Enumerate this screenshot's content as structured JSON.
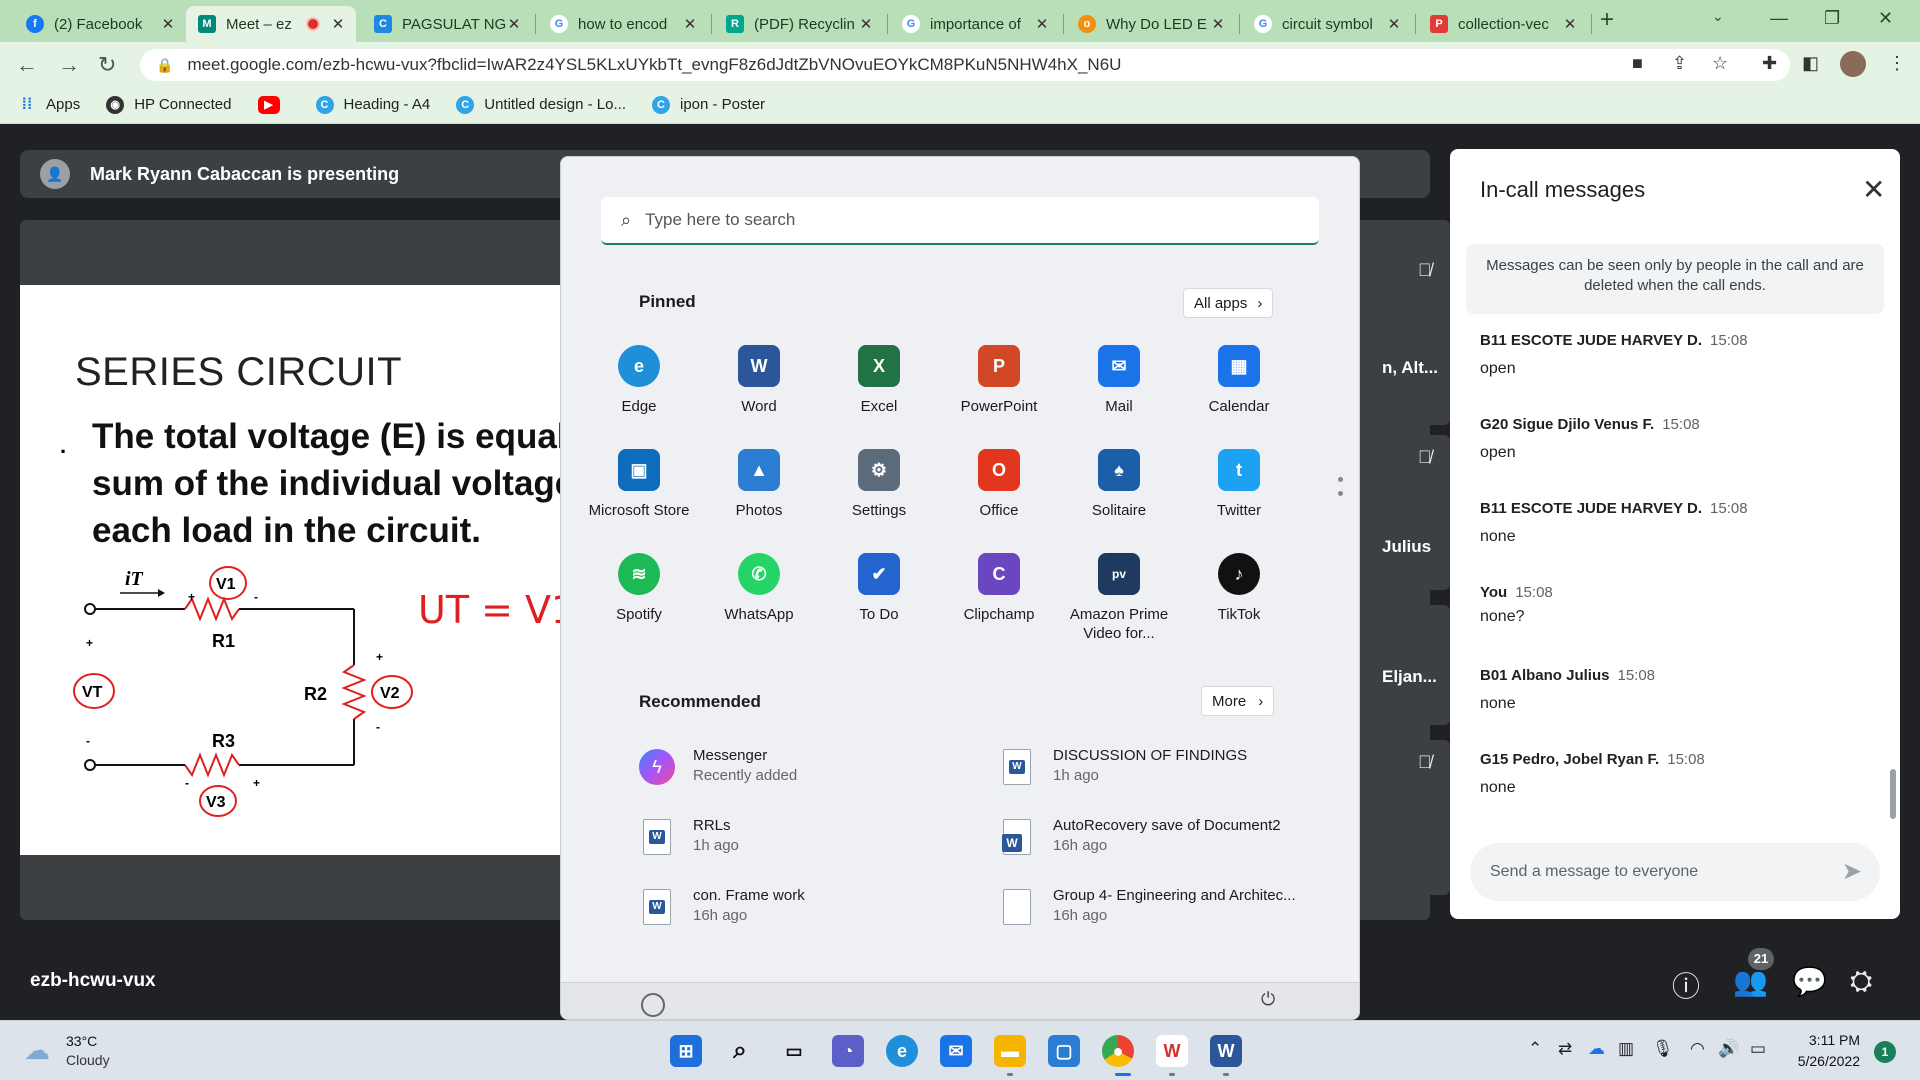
{
  "browser": {
    "tabs": [
      {
        "label": "(2) Facebook",
        "icon": "facebook-icon",
        "color": "#1877f2",
        "glyph": "f"
      },
      {
        "label": "Meet – ez",
        "icon": "google-meet-icon",
        "color": "#00897b",
        "glyph": "M"
      },
      {
        "label": "PAGSULAT NG",
        "icon": "google-classroom-icon",
        "color": "#1e88e5",
        "glyph": "C"
      },
      {
        "label": "how to encod",
        "icon": "google-icon",
        "color": "#4285f4",
        "glyph": "G"
      },
      {
        "label": "(PDF) Recyclin",
        "icon": "researchgate-icon",
        "color": "#00a78e",
        "glyph": "R"
      },
      {
        "label": "importance of",
        "icon": "google-icon",
        "color": "#4285f4",
        "glyph": "G"
      },
      {
        "label": "Why Do LED E",
        "icon": "web-icon",
        "color": "#f29111",
        "glyph": "o"
      },
      {
        "label": "circuit symbol",
        "icon": "google-icon",
        "color": "#4285f4",
        "glyph": "G"
      },
      {
        "label": "collection-vec",
        "icon": "pdf-icon",
        "color": "#e53935",
        "glyph": "P"
      }
    ],
    "new_tab": "+",
    "url": "meet.google.com/ezb-hcwu-vux?fbclid=IwAR2z4YSL5KLxUYkbTt_evngF8z6dJdtZbVNOvuEOYkCM8PKuN5NHW4hX_N6U",
    "bookmarks": [
      {
        "label": "Apps",
        "icon": "apps-grid-icon",
        "color": "#5f6368"
      },
      {
        "label": "HP Connected",
        "icon": "hp-icon",
        "color": "#333333"
      },
      {
        "label": "",
        "icon": "youtube-icon",
        "color": "#ff0000"
      },
      {
        "label": "Heading - A4",
        "icon": "canva-icon",
        "color": "#2fa4e7"
      },
      {
        "label": "Untitled design - Lo...",
        "icon": "canva-icon",
        "color": "#2fa4e7"
      },
      {
        "label": "ipon - Poster",
        "icon": "canva-icon",
        "color": "#2fa4e7"
      }
    ]
  },
  "meet": {
    "presenter_text": "Mark Ryann Cabaccan is presenting",
    "meeting_code": "ezb-hcwu-vux",
    "participant_count": "21",
    "tile_names": [
      "n, Alt...",
      "Julius",
      "Eljan..."
    ]
  },
  "slide": {
    "title": "SERIES CIRCUIT",
    "bullet": ".",
    "body_lines": [
      "The total voltage (E) is equal",
      "sum of the individual voltage",
      "each load in the circuit."
    ],
    "handwritten": "UT = V1 +",
    "labels": {
      "current": "iT",
      "r1": "R1",
      "r2": "R2",
      "r3": "R3",
      "v1": "V1",
      "v2": "V2",
      "v3": "V3",
      "vt": "VT"
    }
  },
  "chat": {
    "title": "In-call messages",
    "notice": "Messages can be seen only by people in the call and are deleted when the call ends.",
    "messages": [
      {
        "sender": "B11 ESCOTE JUDE HARVEY D.",
        "time": "15:08",
        "text": "open"
      },
      {
        "sender": "G20 Sigue Djilo Venus F.",
        "time": "15:08",
        "text": "open"
      },
      {
        "sender": "B11 ESCOTE JUDE HARVEY D.",
        "time": "15:08",
        "text": "none"
      },
      {
        "sender": "You",
        "time": "15:08",
        "text": "none?"
      },
      {
        "sender": "B01 Albano Julius",
        "time": "15:08",
        "text": "none"
      },
      {
        "sender": "G15 Pedro, Jobel Ryan F.",
        "time": "15:08",
        "text": "none"
      }
    ],
    "input_placeholder": "Send a message to everyone"
  },
  "start_menu": {
    "search_placeholder": "Type here to search",
    "pinned_label": "Pinned",
    "all_apps_label": "All apps",
    "pinned": [
      {
        "label": "Edge",
        "icon": "edge-icon",
        "color": "#1e8fd8",
        "glyph": "e"
      },
      {
        "label": "Word",
        "icon": "word-icon",
        "color": "#2b579a",
        "glyph": "W"
      },
      {
        "label": "Excel",
        "icon": "excel-icon",
        "color": "#217346",
        "glyph": "X"
      },
      {
        "label": "PowerPoint",
        "icon": "powerpoint-icon",
        "color": "#d24726",
        "glyph": "P"
      },
      {
        "label": "Mail",
        "icon": "mail-icon",
        "color": "#1a73e8",
        "glyph": "✉"
      },
      {
        "label": "Calendar",
        "icon": "calendar-icon",
        "color": "#1a73e8",
        "glyph": "▦"
      },
      {
        "label": "Microsoft Store",
        "icon": "store-icon",
        "color": "#0f6cbd",
        "glyph": "▣"
      },
      {
        "label": "Photos",
        "icon": "photos-icon",
        "color": "#2b7cd3",
        "glyph": "▲"
      },
      {
        "label": "Settings",
        "icon": "settings-icon",
        "color": "#5b6b7c",
        "glyph": "⚙"
      },
      {
        "label": "Office",
        "icon": "office-icon",
        "color": "#e3361f",
        "glyph": "O"
      },
      {
        "label": "Solitaire",
        "icon": "solitaire-icon",
        "color": "#1b5fa8",
        "glyph": "♠"
      },
      {
        "label": "Twitter",
        "icon": "twitter-icon",
        "color": "#1da1f2",
        "glyph": "t"
      },
      {
        "label": "Spotify",
        "icon": "spotify-icon",
        "color": "#1db954",
        "glyph": "≋"
      },
      {
        "label": "WhatsApp",
        "icon": "whatsapp-icon",
        "color": "#25d366",
        "glyph": "✆"
      },
      {
        "label": "To Do",
        "icon": "todo-icon",
        "color": "#2564cf",
        "glyph": "✔"
      },
      {
        "label": "Clipchamp",
        "icon": "clipchamp-icon",
        "color": "#6b46c1",
        "glyph": "C"
      },
      {
        "label": "Amazon Prime Video for...",
        "icon": "prime-video-icon",
        "color": "#1f3a5f",
        "glyph": "pv"
      },
      {
        "label": "TikTok",
        "icon": "tiktok-icon",
        "color": "#111111",
        "glyph": "♪"
      }
    ],
    "recommended_label": "Recommended",
    "more_label": "More",
    "recommended": [
      {
        "name": "Messenger",
        "sub": "Recently added",
        "icon": "messenger-icon"
      },
      {
        "name": "DISCUSSION OF FINDINGS",
        "sub": "1h ago",
        "icon": "word-doc-icon"
      },
      {
        "name": "RRLs",
        "sub": "1h ago",
        "icon": "word-doc-icon"
      },
      {
        "name": "AutoRecovery save of Document2",
        "sub": "16h ago",
        "icon": "word-autorecover-icon"
      },
      {
        "name": "con. Frame work",
        "sub": "16h ago",
        "icon": "word-doc-icon"
      },
      {
        "name": "Group 4- Engineering and Architec...",
        "sub": "16h ago",
        "icon": "blank-doc-icon"
      }
    ]
  },
  "taskbar": {
    "temp": "33°C",
    "condition": "Cloudy",
    "time": "3:11 PM",
    "date": "5/26/2022",
    "notifications": "1"
  }
}
